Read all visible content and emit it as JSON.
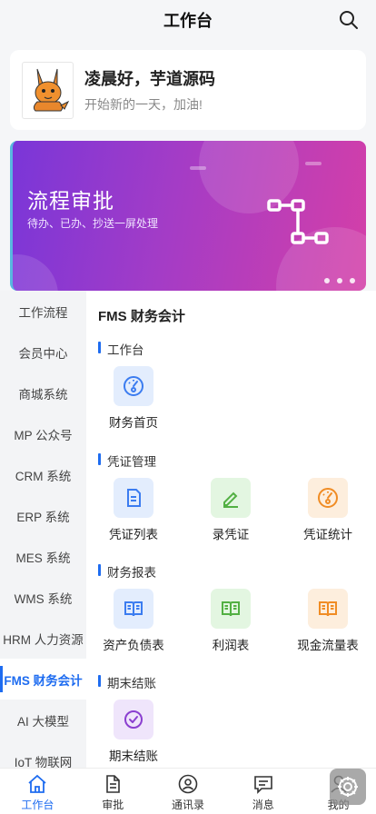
{
  "header": {
    "title": "工作台",
    "search_icon": "search-icon"
  },
  "greeting": {
    "hello": "凌晨好，芋道源码",
    "sub": "开始新的一天，加油!"
  },
  "banner": {
    "title": "流程审批",
    "subtitle": "待办、已办、抄送一屏处理",
    "slide_count": 3
  },
  "sidebar": {
    "items": [
      {
        "label": "工作流程"
      },
      {
        "label": "会员中心"
      },
      {
        "label": "商城系统"
      },
      {
        "label": "MP 公众号"
      },
      {
        "label": "CRM 系统"
      },
      {
        "label": "ERP 系统"
      },
      {
        "label": "MES 系统"
      },
      {
        "label": "WMS 系统"
      },
      {
        "label": "HRM 人力资源"
      },
      {
        "label": "FMS 财务会计",
        "active": true
      },
      {
        "label": "AI 大模型"
      },
      {
        "label": "IoT 物联网"
      }
    ]
  },
  "content": {
    "title": "FMS 财务会计",
    "sections": [
      {
        "name": "工作台",
        "items": [
          {
            "label": "财务首页",
            "icon": "dashboard-icon",
            "color": "#3b7cf0"
          }
        ]
      },
      {
        "name": "凭证管理",
        "items": [
          {
            "label": "凭证列表",
            "icon": "document-icon",
            "color": "#3b7cf0"
          },
          {
            "label": "录凭证",
            "icon": "pencil-icon",
            "color": "#52b043"
          },
          {
            "label": "凭证统计",
            "icon": "gauge-icon",
            "color": "#f08c24"
          }
        ]
      },
      {
        "name": "财务报表",
        "items": [
          {
            "label": "资产负债表",
            "icon": "book-icon",
            "color": "#3b7cf0"
          },
          {
            "label": "利润表",
            "icon": "book-icon",
            "color": "#52b043"
          },
          {
            "label": "现金流量表",
            "icon": "book-icon",
            "color": "#f08c24"
          }
        ]
      },
      {
        "name": "期末结账",
        "items": [
          {
            "label": "期末结账",
            "icon": "check-circle-icon",
            "color": "#8a3fd0"
          }
        ]
      }
    ]
  },
  "tabbar": {
    "tabs": [
      {
        "label": "工作台",
        "icon": "home-icon",
        "active": true
      },
      {
        "label": "审批",
        "icon": "document-icon"
      },
      {
        "label": "通讯录",
        "icon": "contacts-icon"
      },
      {
        "label": "消息",
        "icon": "message-icon"
      },
      {
        "label": "我的",
        "icon": "user-icon"
      }
    ]
  },
  "colors": {
    "accent": "#1e6cf0",
    "banner_start": "#7a36d8",
    "banner_end": "#d43fa8"
  }
}
